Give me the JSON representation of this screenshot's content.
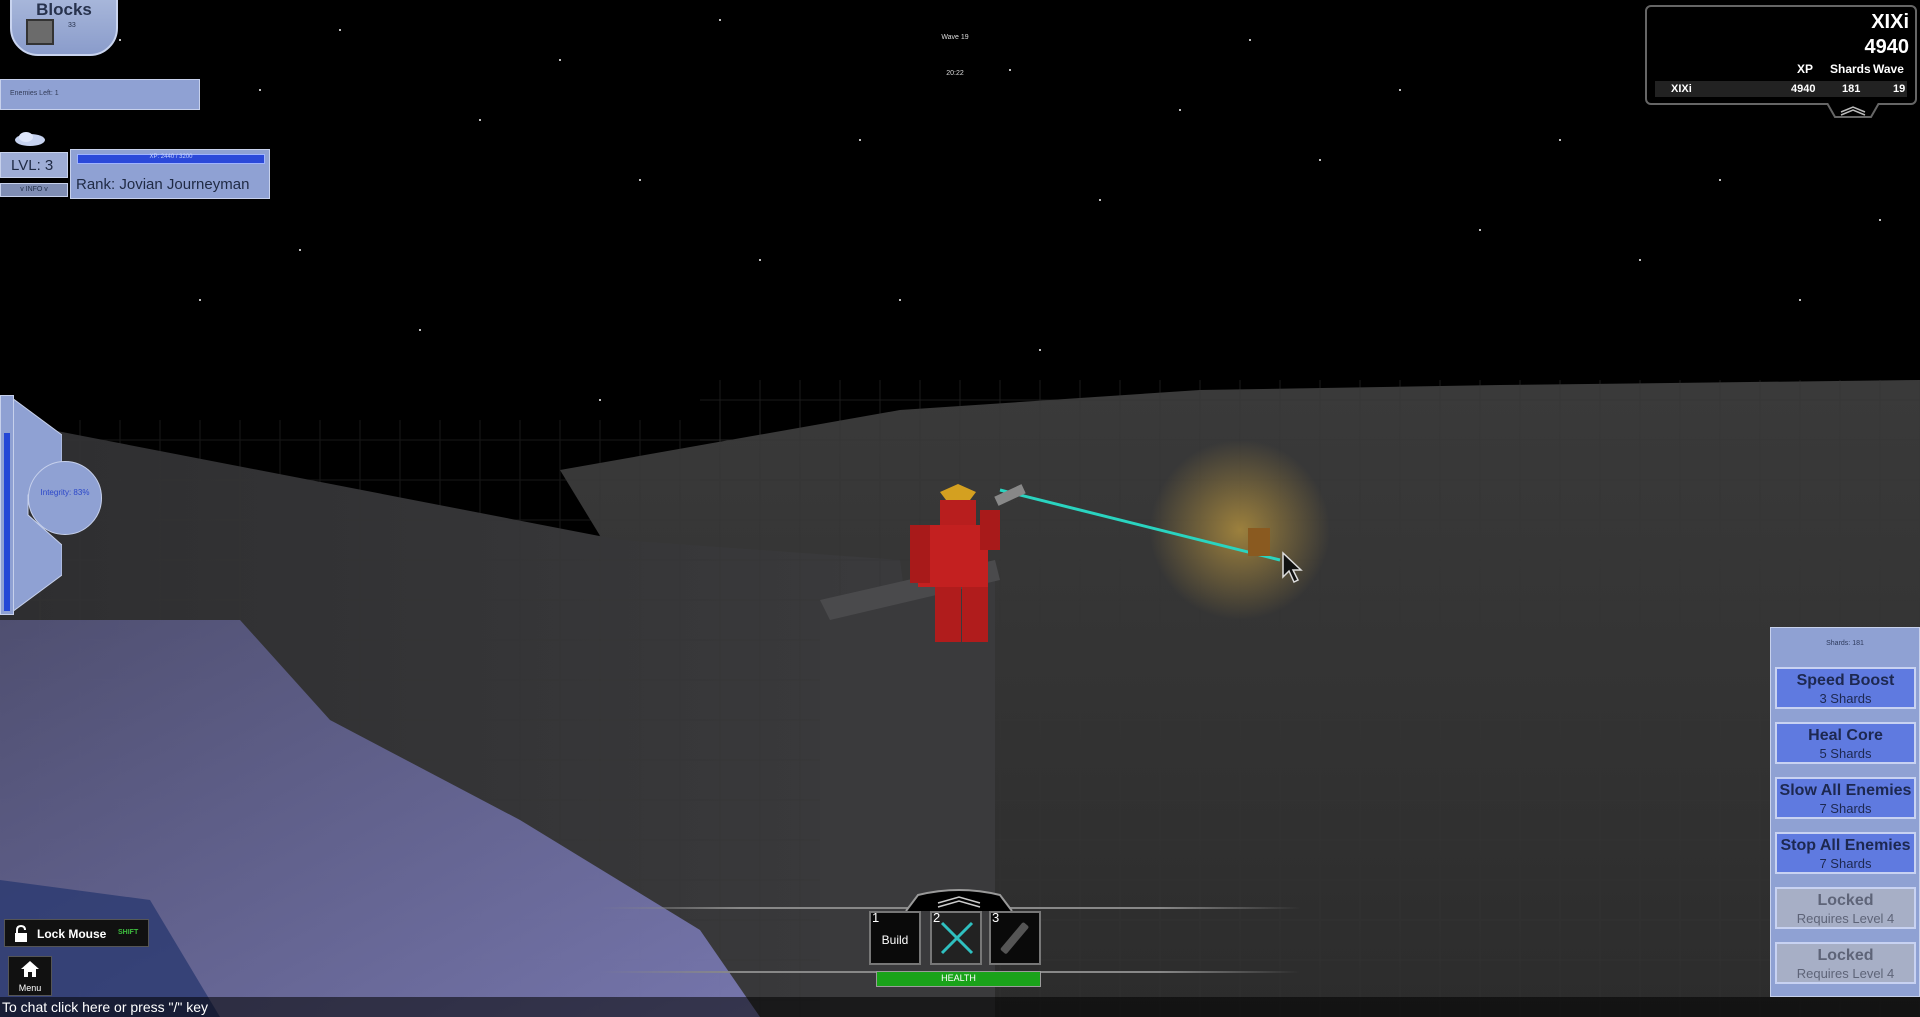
{
  "blocks": {
    "title": "Blocks",
    "count": "33"
  },
  "enemies_left": "Enemies Left: 1",
  "level": {
    "lvl": "LVL: 3",
    "xp": "XP: 2440 / 3200",
    "rank": "Rank: Jovian Journeyman",
    "info_button": "v INFO v"
  },
  "integrity": {
    "label": "Integrity: 83%",
    "level": 0.83
  },
  "wave": {
    "label": "Wave 19",
    "timer": "20:22"
  },
  "leaderboard": {
    "player_name": "XIXi",
    "player_score": "4940",
    "headers": [
      "XP",
      "Shards",
      "Wave"
    ],
    "rows": [
      {
        "name": "XIXi",
        "xp": "4940",
        "shards": "181",
        "wave": "19"
      }
    ]
  },
  "shop": {
    "shards": "Shards: 181",
    "items": [
      {
        "title": "Speed Boost",
        "cost": "3 Shards"
      },
      {
        "title": "Heal Core",
        "cost": "5 Shards"
      },
      {
        "title": "Slow All Enemies",
        "cost": "7 Shards"
      },
      {
        "title": "Stop All Enemies",
        "cost": "7 Shards"
      },
      {
        "title": "Locked",
        "cost": "Requires Level 4"
      },
      {
        "title": "Locked",
        "cost": "Requires Level 4"
      }
    ]
  },
  "hotbar": {
    "slots": [
      {
        "num": "1",
        "label": "Build"
      },
      {
        "num": "2",
        "label": ""
      },
      {
        "num": "3",
        "label": ""
      }
    ],
    "health_label": "HEALTH",
    "health": 1.0
  },
  "lock_mouse": {
    "label": "Lock Mouse",
    "key": "SHIFT"
  },
  "menu": {
    "label": "Menu"
  },
  "chat": {
    "hint": "To chat click here or press \"/\" key"
  },
  "colors": {
    "panel": "#8fa1d3",
    "accent": "#2447d6",
    "health": "#1aa31a"
  }
}
